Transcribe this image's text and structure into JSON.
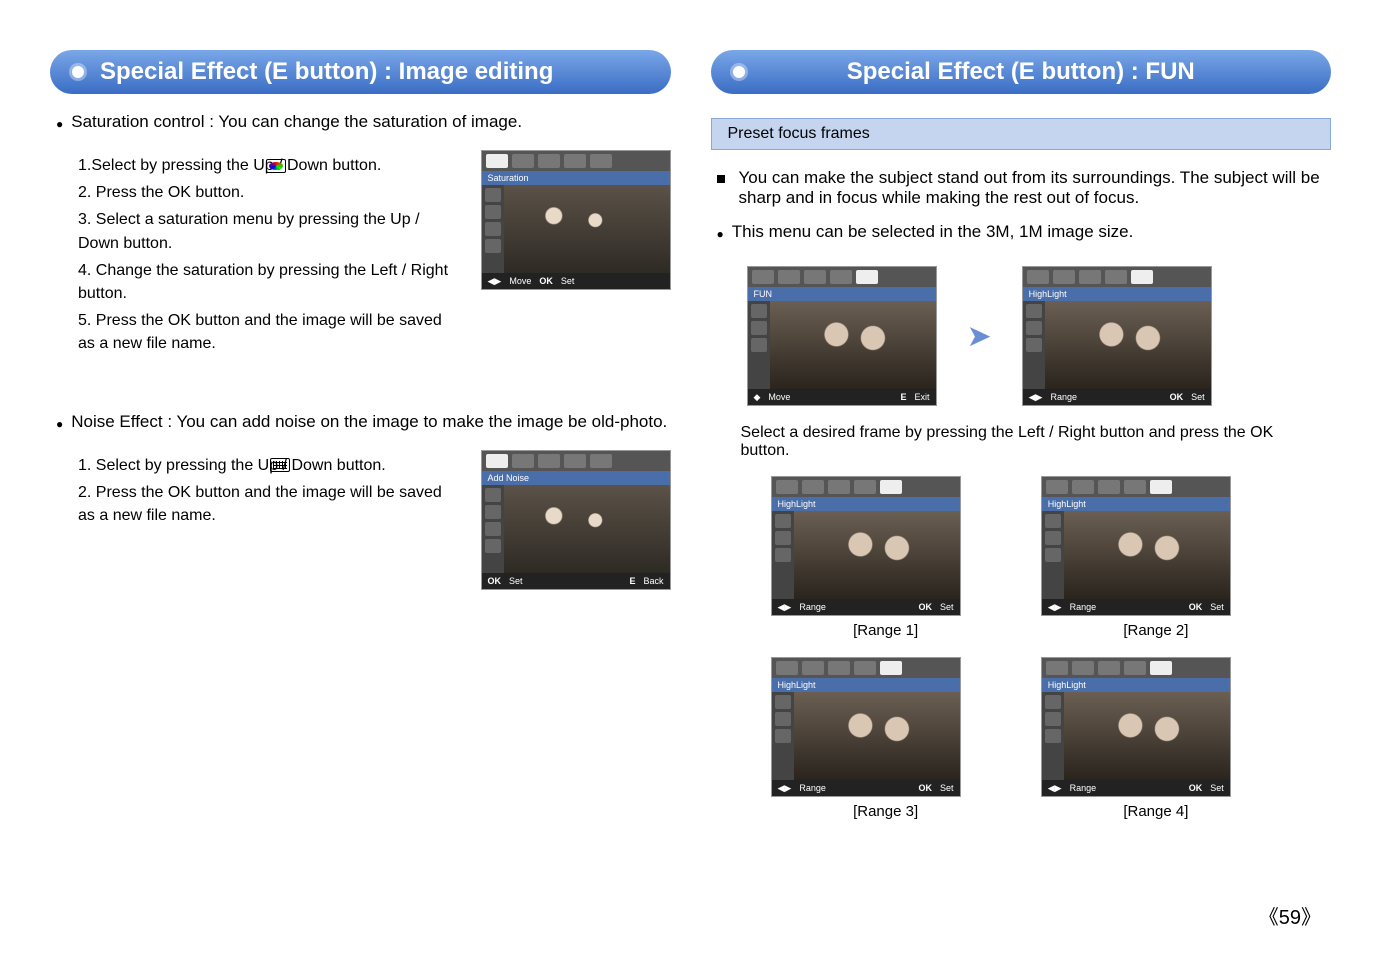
{
  "left": {
    "title": "Special Effect (E button) : Image editing",
    "saturation": {
      "heading": "Saturation control : You can change the saturation of image.",
      "steps": [
        "1.Select          by pressing the Up / Down button.",
        "2. Press the OK button.",
        "3. Select a saturation menu by pressing the Up / Down button.",
        "4. Change the saturation by pressing the Left / Right button.",
        "5. Press the OK button and the image will be saved as a new file name."
      ],
      "thumb": {
        "label": "Saturation",
        "foot_left": "Move",
        "foot_ok": "OK",
        "foot_right": "Set",
        "arrow": "◀▶"
      }
    },
    "noise": {
      "heading": "Noise Effect : You can add noise on the image to make the image be old-photo.",
      "steps": [
        "1. Select          by pressing the Up / Down button.",
        "2. Press the OK button and the image will be saved as a new file name."
      ],
      "thumb": {
        "label": "Add Noise",
        "foot_ok": "OK",
        "foot_ok_txt": "Set",
        "foot_e": "E",
        "foot_e_txt": "Back"
      }
    }
  },
  "right": {
    "title": "Special Effect (E button) :  FUN",
    "tag": "Preset focus frames",
    "para1": "You can make the subject stand out from its surroundings. The subject will be sharp and in focus while making the rest out of focus.",
    "para2": "This menu can be selected in the 3M, 1M image size.",
    "funThumb": {
      "label": "FUN",
      "foot_arrow": "◆",
      "foot_left": "Move",
      "foot_e": "E",
      "foot_e_txt": "Exit"
    },
    "hlThumb": {
      "label": "HighLight",
      "foot_arrow": "◀▶",
      "foot_left": "Range",
      "foot_ok": "OK",
      "foot_ok_txt": "Set"
    },
    "selectText": "Select a desired frame by pressing the Left / Right button and press the OK button.",
    "ranges": {
      "label": "HighLight",
      "foot_arrow": "◀▶",
      "foot_left": "Range",
      "foot_ok": "OK",
      "foot_ok_txt": "Set",
      "captions": [
        "[Range 1]",
        "[Range 2]",
        "[Range 3]",
        "[Range 4]"
      ]
    }
  },
  "pageNumber": "59"
}
